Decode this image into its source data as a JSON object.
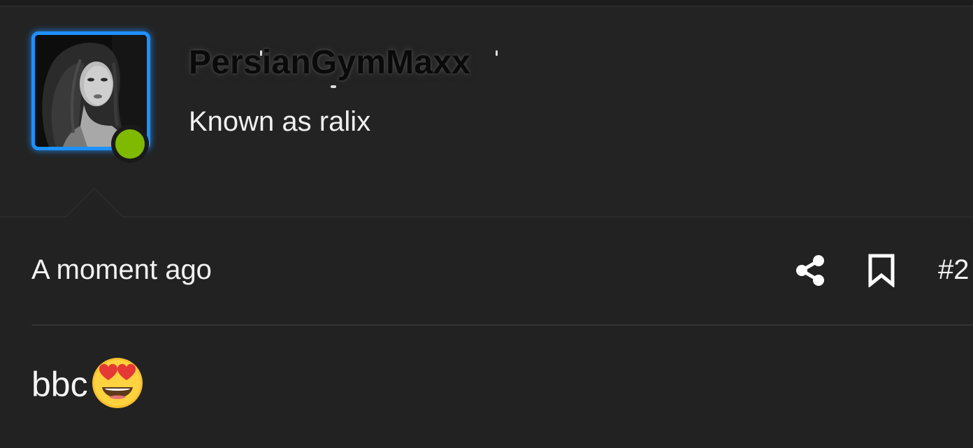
{
  "user": {
    "username": "PersianGymMaxx",
    "title": "Known as ralix",
    "avatar_icon": "avatar-photo",
    "online_status_color": "#7fba00",
    "avatar_border_color": "#1e90ff"
  },
  "post": {
    "timestamp": "A moment ago",
    "number": "#2",
    "body_text": "bbc",
    "body_emoji": "heart-eyes-emoji",
    "actions": {
      "share_icon": "share-icon",
      "bookmark_icon": "bookmark-icon"
    }
  },
  "colors": {
    "background": "#222222",
    "text": "#f2f2f2",
    "divider": "#333333"
  }
}
